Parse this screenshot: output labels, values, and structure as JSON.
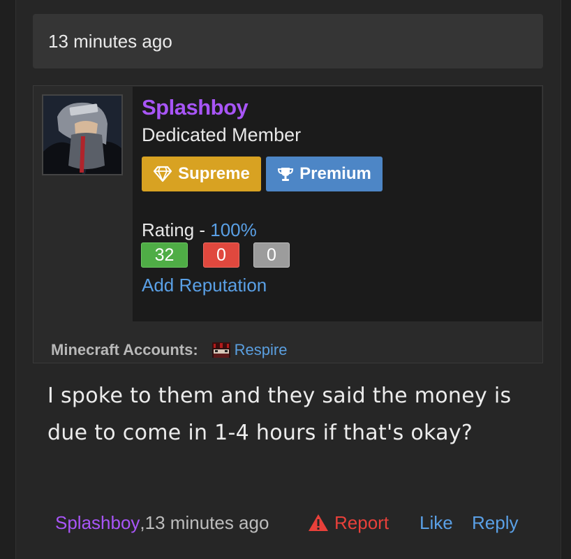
{
  "post": {
    "time_header": "13 minutes ago",
    "message": "I spoke to them and they said the money is due to come in 1-4 hours if that's okay?"
  },
  "user": {
    "name": "Splashboy",
    "title": "Dedicated Member",
    "badges": [
      {
        "label": "Supreme",
        "icon": "diamond-icon",
        "color": "#d8a222"
      },
      {
        "label": "Premium",
        "icon": "trophy-icon",
        "color": "#4d86c6"
      }
    ],
    "rating_label": "Rating - ",
    "rating_percent": "100%",
    "reputation": {
      "positive": "32",
      "negative": "0",
      "neutral": "0"
    },
    "add_reputation": "Add Reputation",
    "minecraft_label": "Minecraft Accounts:",
    "minecraft_account": "Respire"
  },
  "footer": {
    "author": "Splashboy",
    "separator": ", ",
    "time": "13 minutes ago",
    "report": "Report",
    "like": "Like",
    "reply": "Reply"
  },
  "colors": {
    "username": "#a855f7",
    "link": "#5aa0e6",
    "report": "#e8403a",
    "rep_positive": "#4fad46",
    "rep_negative": "#e0483e",
    "rep_neutral": "#9c9c9c"
  }
}
